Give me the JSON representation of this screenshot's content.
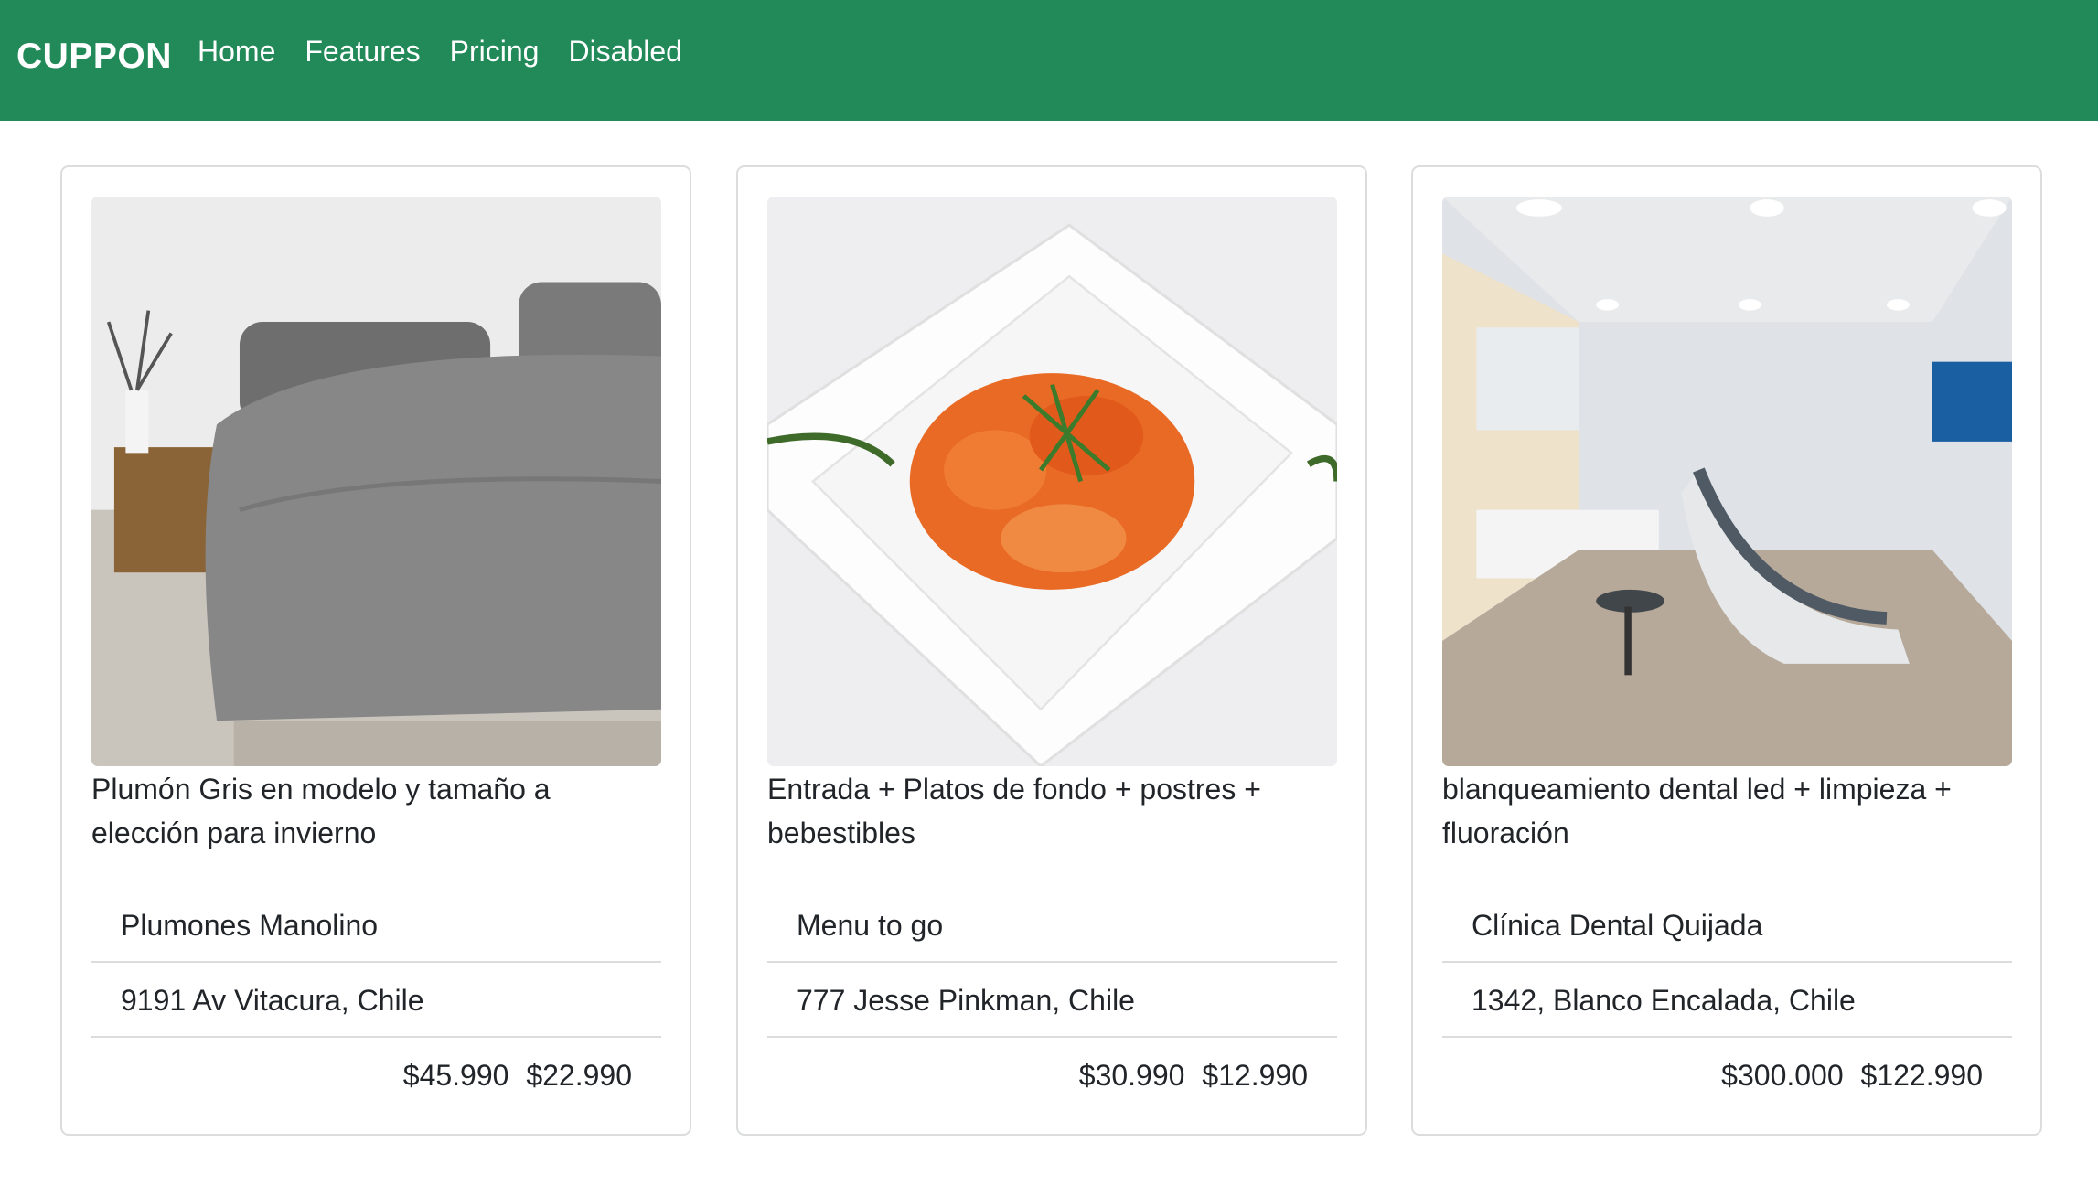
{
  "navbar": {
    "brand": "CUPPON",
    "links": [
      {
        "label": "Home"
      },
      {
        "label": "Features"
      },
      {
        "label": "Pricing"
      },
      {
        "label": "Disabled"
      }
    ],
    "background": "#218a58"
  },
  "cards": [
    {
      "title": "Plumón Gris en modelo y tamaño a elección para invierno",
      "store": "Plumones Manolino",
      "address": "9191 Av Vitacura, Chile",
      "old_price": "$45.990",
      "new_price": "$22.990",
      "image": "bed-photo"
    },
    {
      "title": "Entrada + Platos de fondo + postres + bebestibles",
      "store": "Menu to go",
      "address": "777 Jesse Pinkman, Chile",
      "old_price": "$30.990",
      "new_price": "$12.990",
      "image": "food-photo"
    },
    {
      "title": "blanqueamiento dental led + limpieza + fluoración",
      "store": "Clínica Dental Quijada",
      "address": "1342, Blanco Encalada, Chile",
      "old_price": "$300.000",
      "new_price": "$122.990",
      "image": "dental-clinic-photo"
    }
  ]
}
